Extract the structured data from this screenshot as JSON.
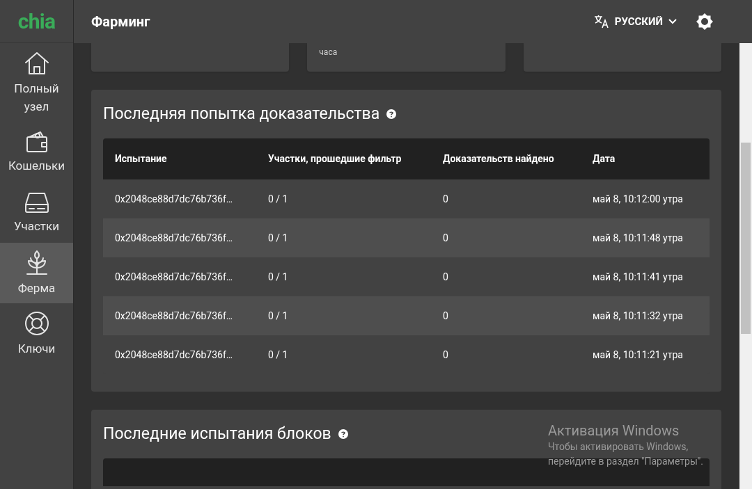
{
  "logo": "chia",
  "header": {
    "title": "Фарминг",
    "language": "РУССКИЙ"
  },
  "sidebar": {
    "items": [
      {
        "label": "Полный узел",
        "selected": false
      },
      {
        "label": "Кошельки",
        "selected": false
      },
      {
        "label": "Участки",
        "selected": false
      },
      {
        "label": "Ферма",
        "selected": true
      },
      {
        "label": "Ключи",
        "selected": false
      }
    ]
  },
  "top_card_text": "часа",
  "proof_section": {
    "title": "Последняя попытка доказательства",
    "table": {
      "columns": [
        "Испытание",
        "Участки, прошедшие фильтр",
        "Доказательств найдено",
        "Дата"
      ],
      "rows": [
        [
          "0x2048ce88d7dc76b736f…",
          "0 / 1",
          "0",
          "май 8, 10:12:00 утра"
        ],
        [
          "0x2048ce88d7dc76b736f…",
          "0 / 1",
          "0",
          "май 8, 10:11:48 утра"
        ],
        [
          "0x2048ce88d7dc76b736f…",
          "0 / 1",
          "0",
          "май 8, 10:11:41 утра"
        ],
        [
          "0x2048ce88d7dc76b736f…",
          "0 / 1",
          "0",
          "май 8, 10:11:32 утра"
        ],
        [
          "0x2048ce88d7dc76b736f…",
          "0 / 1",
          "0",
          "май 8, 10:11:21 утра"
        ]
      ]
    }
  },
  "blocks_section": {
    "title": "Последние испытания блоков"
  },
  "activation_notice": {
    "title": "Активация Windows",
    "lines": [
      "Чтобы активировать Windows,",
      "перейдите в раздел \"Параметры\"."
    ]
  }
}
